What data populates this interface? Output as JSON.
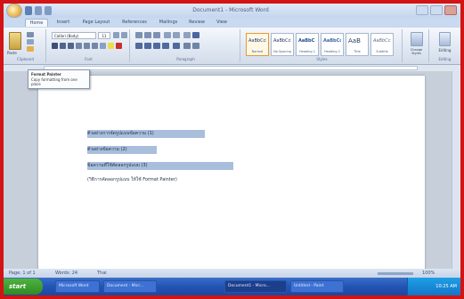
{
  "window": {
    "title": "Document1 - Microsoft Word",
    "quick_access": [
      "save-icon",
      "undo-icon",
      "redo-icon"
    ]
  },
  "ribbon": {
    "tabs": [
      {
        "label": "Home",
        "active": true
      },
      {
        "label": "Insert",
        "active": false
      },
      {
        "label": "Page Layout",
        "active": false
      },
      {
        "label": "References",
        "active": false
      },
      {
        "label": "Mailings",
        "active": false
      },
      {
        "label": "Review",
        "active": false
      },
      {
        "label": "View",
        "active": false
      }
    ],
    "groups": {
      "clipboard": "Clipboard",
      "font": "Font",
      "paragraph": "Paragraph",
      "styles": "Styles",
      "editing": "Editing"
    },
    "font_name": "Calibri (Body)",
    "font_size": "11",
    "paste_label": "Paste",
    "change_styles_label": "Change Styles",
    "editing_label": "Editing",
    "styles": [
      {
        "preview": "AaBbCcDc",
        "name": "Normal",
        "selected": true
      },
      {
        "preview": "AaBbCcDc",
        "name": "No Spacing",
        "selected": false
      },
      {
        "preview": "AaBbC",
        "name": "Heading 1",
        "selected": false
      },
      {
        "preview": "AaBbCc",
        "name": "Heading 2",
        "selected": false
      },
      {
        "preview": "AaB",
        "name": "Title",
        "selected": false
      },
      {
        "preview": "AaBbCc.",
        "name": "Subtitle",
        "selected": false
      }
    ]
  },
  "tooltip": {
    "line1": "Format Painter",
    "line2": "Copy formatting from one place"
  },
  "document": {
    "lines": [
      {
        "text": "ตัวอย่างการจัดรูปแบบข้อความ (1)",
        "highlighted": true
      },
      {
        "text": "ตัวอย่างข้อความ (2)",
        "highlighted": true
      },
      {
        "text": "ข้อความที่ใช้คัดลอกรูปแบบ (3)",
        "highlighted": true
      },
      {
        "text": "(วิธีการคัดลอกรูปแบบ ให้ใช้ Format Painter)",
        "highlighted": false
      }
    ]
  },
  "statusbar": {
    "page": "Page: 1 of 1",
    "words": "Words: 24",
    "language": "Thai",
    "zoom": "100%"
  },
  "taskbar": {
    "start_label": "start",
    "tasks": [
      {
        "label": "Microsoft Word",
        "active": false
      },
      {
        "label": "Document - Micr...",
        "active": false
      },
      {
        "label": "Document1 - Micro...",
        "active": true
      },
      {
        "label": "Untitled - Paint",
        "active": false
      }
    ],
    "clock": "10:25 AM"
  }
}
